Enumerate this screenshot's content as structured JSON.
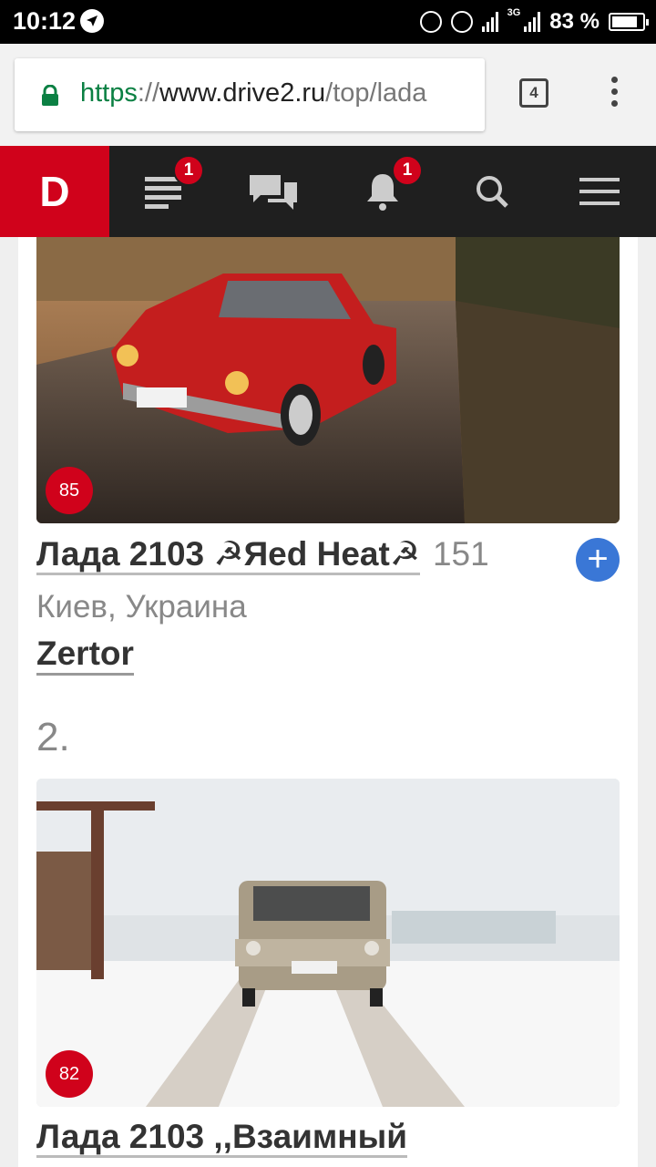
{
  "status_bar": {
    "time": "10:12",
    "network": "3G",
    "battery_percent": 83,
    "battery_text": "83 %"
  },
  "browser": {
    "url_scheme": "https",
    "url_sep": "://",
    "url_host": "www.drive2.ru",
    "url_path": "/top/lada",
    "tab_count": "4"
  },
  "site_nav": {
    "logo": "D",
    "feed_badge": "1",
    "notifications_badge": "1"
  },
  "entries": [
    {
      "rating": "85",
      "title": "Лада 2103 ☭Яed Heat☭",
      "votes": "151",
      "location": "Киев, Украина",
      "author": "Zertor"
    },
    {
      "rank": "2.",
      "rating": "82",
      "title": "Лада 2103 ,,Взаимный"
    }
  ],
  "colors": {
    "brand_red": "#d0021b",
    "follow_blue": "#3a77d6",
    "nav_dark": "#1f1f1f"
  }
}
